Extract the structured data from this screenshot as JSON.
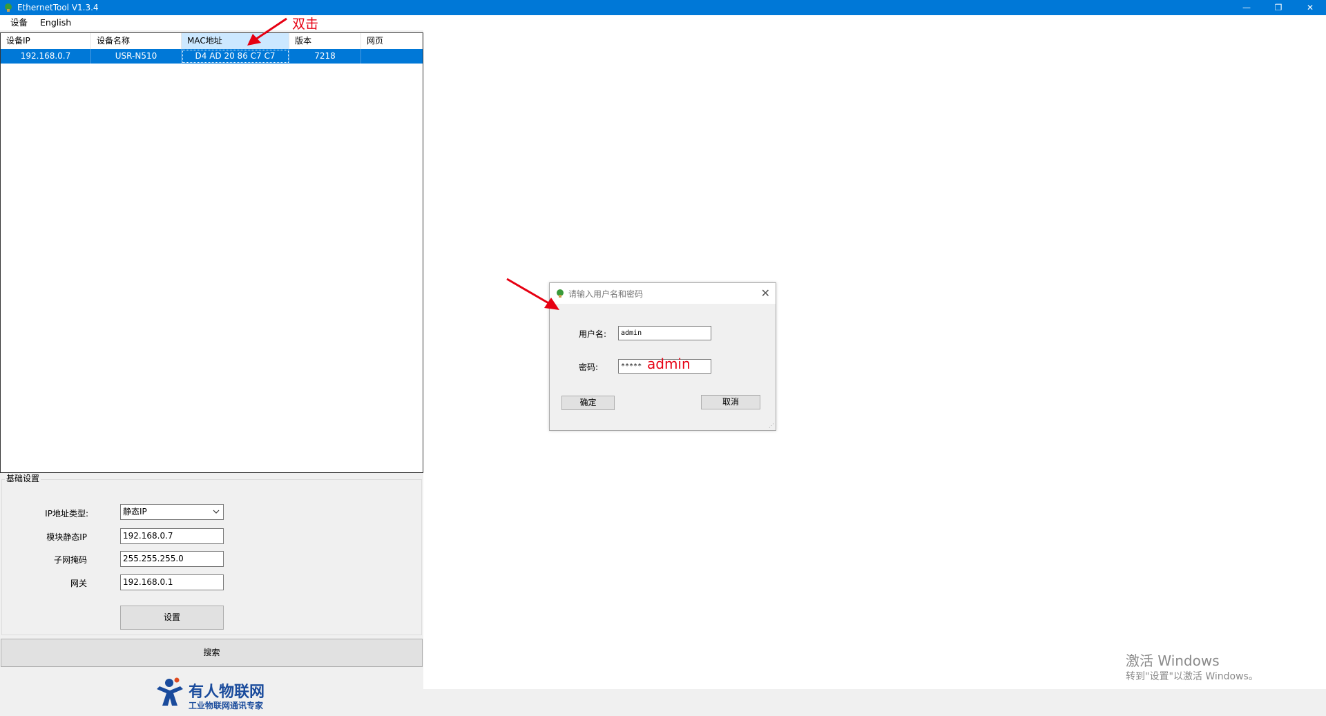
{
  "window": {
    "title": "EthernetTool V1.3.4",
    "controls": {
      "minimize": "—",
      "restore": "❐",
      "close": "✕"
    }
  },
  "menu": {
    "items": [
      "设备",
      "English"
    ]
  },
  "device_list": {
    "columns": [
      "设备IP",
      "设备名称",
      "MAC地址",
      "版本",
      "网页"
    ],
    "rows": [
      {
        "ip": "192.168.0.7",
        "name": "USR-N510",
        "mac": "D4 AD 20 86 C7 C7",
        "version": "7218",
        "web": ""
      }
    ]
  },
  "basic_settings": {
    "title": "基础设置",
    "ip_type_label": "IP地址类型:",
    "ip_type_value": "静态IP",
    "static_ip_label": "模块静态IP",
    "static_ip_value": "192.168.0.7",
    "subnet_label": "子网掩码",
    "subnet_value": "255.255.255.0",
    "gateway_label": "网关",
    "gateway_value": "192.168.0.1",
    "set_button": "设置"
  },
  "search_button": "搜索",
  "logo": {
    "main": "有人物联网",
    "sub": "工业物联网通讯专家"
  },
  "login_dialog": {
    "title": "请输入用户名和密码",
    "username_label": "用户名:",
    "username_value": "admin",
    "password_label": "密码:",
    "password_value": "*****",
    "ok_button": "确定",
    "cancel_button": "取消"
  },
  "annotations": {
    "double_click": "双击",
    "password_hint": "admin"
  },
  "watermark": {
    "title": "激活 Windows",
    "subtitle": "转到\"设置\"以激活 Windows。"
  },
  "colors": {
    "titlebar": "#0078d7",
    "selection": "#0078d7",
    "annotation": "#e60012",
    "brand": "#1a4b9c"
  },
  "icons": [
    "app-icon",
    "dropdown-chevron-icon",
    "close-icon",
    "resize-grip-icon",
    "logo-person-icon"
  ]
}
